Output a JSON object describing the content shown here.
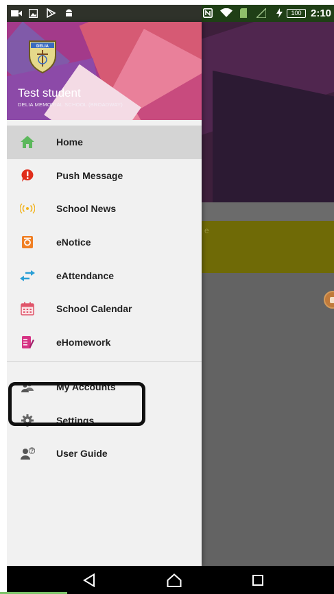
{
  "status_bar": {
    "time": "2:10",
    "battery_level": "100",
    "icons": [
      "video-icon",
      "gallery-icon",
      "play-store-icon",
      "android-icon",
      "nfc-icon",
      "wifi-icon",
      "sim-icon",
      "signal-icon",
      "charging-icon"
    ]
  },
  "drawer": {
    "user_name": "Test student",
    "school_name": "DELIA MEMORIAL SCHOOL (BROADWAY)",
    "logo_text": "DELIA",
    "items": [
      {
        "label": "Home",
        "icon": "home-icon",
        "active": true,
        "color": "#5cb85c"
      },
      {
        "label": "Push Message",
        "icon": "alert-bubble-icon",
        "active": false,
        "color": "#e02d1b"
      },
      {
        "label": "School News",
        "icon": "broadcast-icon",
        "active": false,
        "color": "#f2b31b"
      },
      {
        "label": "eNotice",
        "icon": "notice-icon",
        "active": false,
        "color": "#f07f24"
      },
      {
        "label": "eAttendance",
        "icon": "swap-arrows-icon",
        "active": false,
        "color": "#2a9fd6"
      },
      {
        "label": "School Calendar",
        "icon": "calendar-icon",
        "active": false,
        "color": "#e0556a"
      },
      {
        "label": "eHomework",
        "icon": "homework-icon",
        "active": false,
        "color": "#d63384"
      }
    ],
    "secondary_items": [
      {
        "label": "My Accounts",
        "icon": "accounts-icon",
        "color": "#666666"
      },
      {
        "label": "Settings",
        "icon": "gear-icon",
        "color": "#666666"
      },
      {
        "label": "User Guide",
        "icon": "user-guide-icon",
        "color": "#666666"
      }
    ]
  },
  "background": {
    "banner_text": "e",
    "accent": "#6f6a06"
  },
  "nav_bar": {
    "buttons": [
      "back-icon",
      "home-nav-icon",
      "recents-icon"
    ]
  }
}
